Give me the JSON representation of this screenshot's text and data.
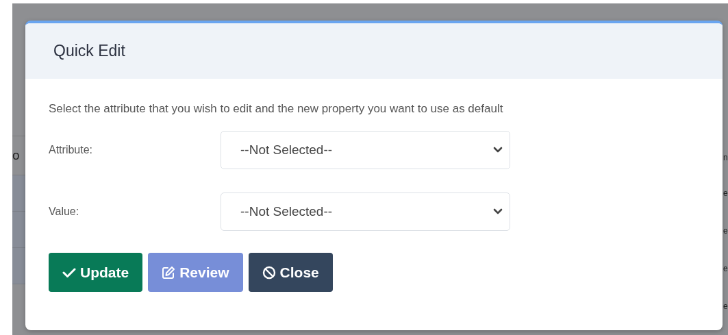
{
  "background_table": {
    "left_cells": [
      "o"
    ],
    "right_cells": [
      "n",
      "e",
      "e",
      "e",
      "e"
    ]
  },
  "dialog": {
    "title": "Quick Edit",
    "description": "Select the attribute that you wish to edit and the new property you want to use as default",
    "fields": [
      {
        "label": "Attribute:",
        "value": "--Not Selected--"
      },
      {
        "label": "Value:",
        "value": "--Not Selected--"
      }
    ],
    "buttons": [
      {
        "label": "Update",
        "kind": "update",
        "disabled": false
      },
      {
        "label": "Review",
        "kind": "review",
        "disabled": true
      },
      {
        "label": "Close",
        "kind": "close",
        "disabled": false
      }
    ]
  }
}
